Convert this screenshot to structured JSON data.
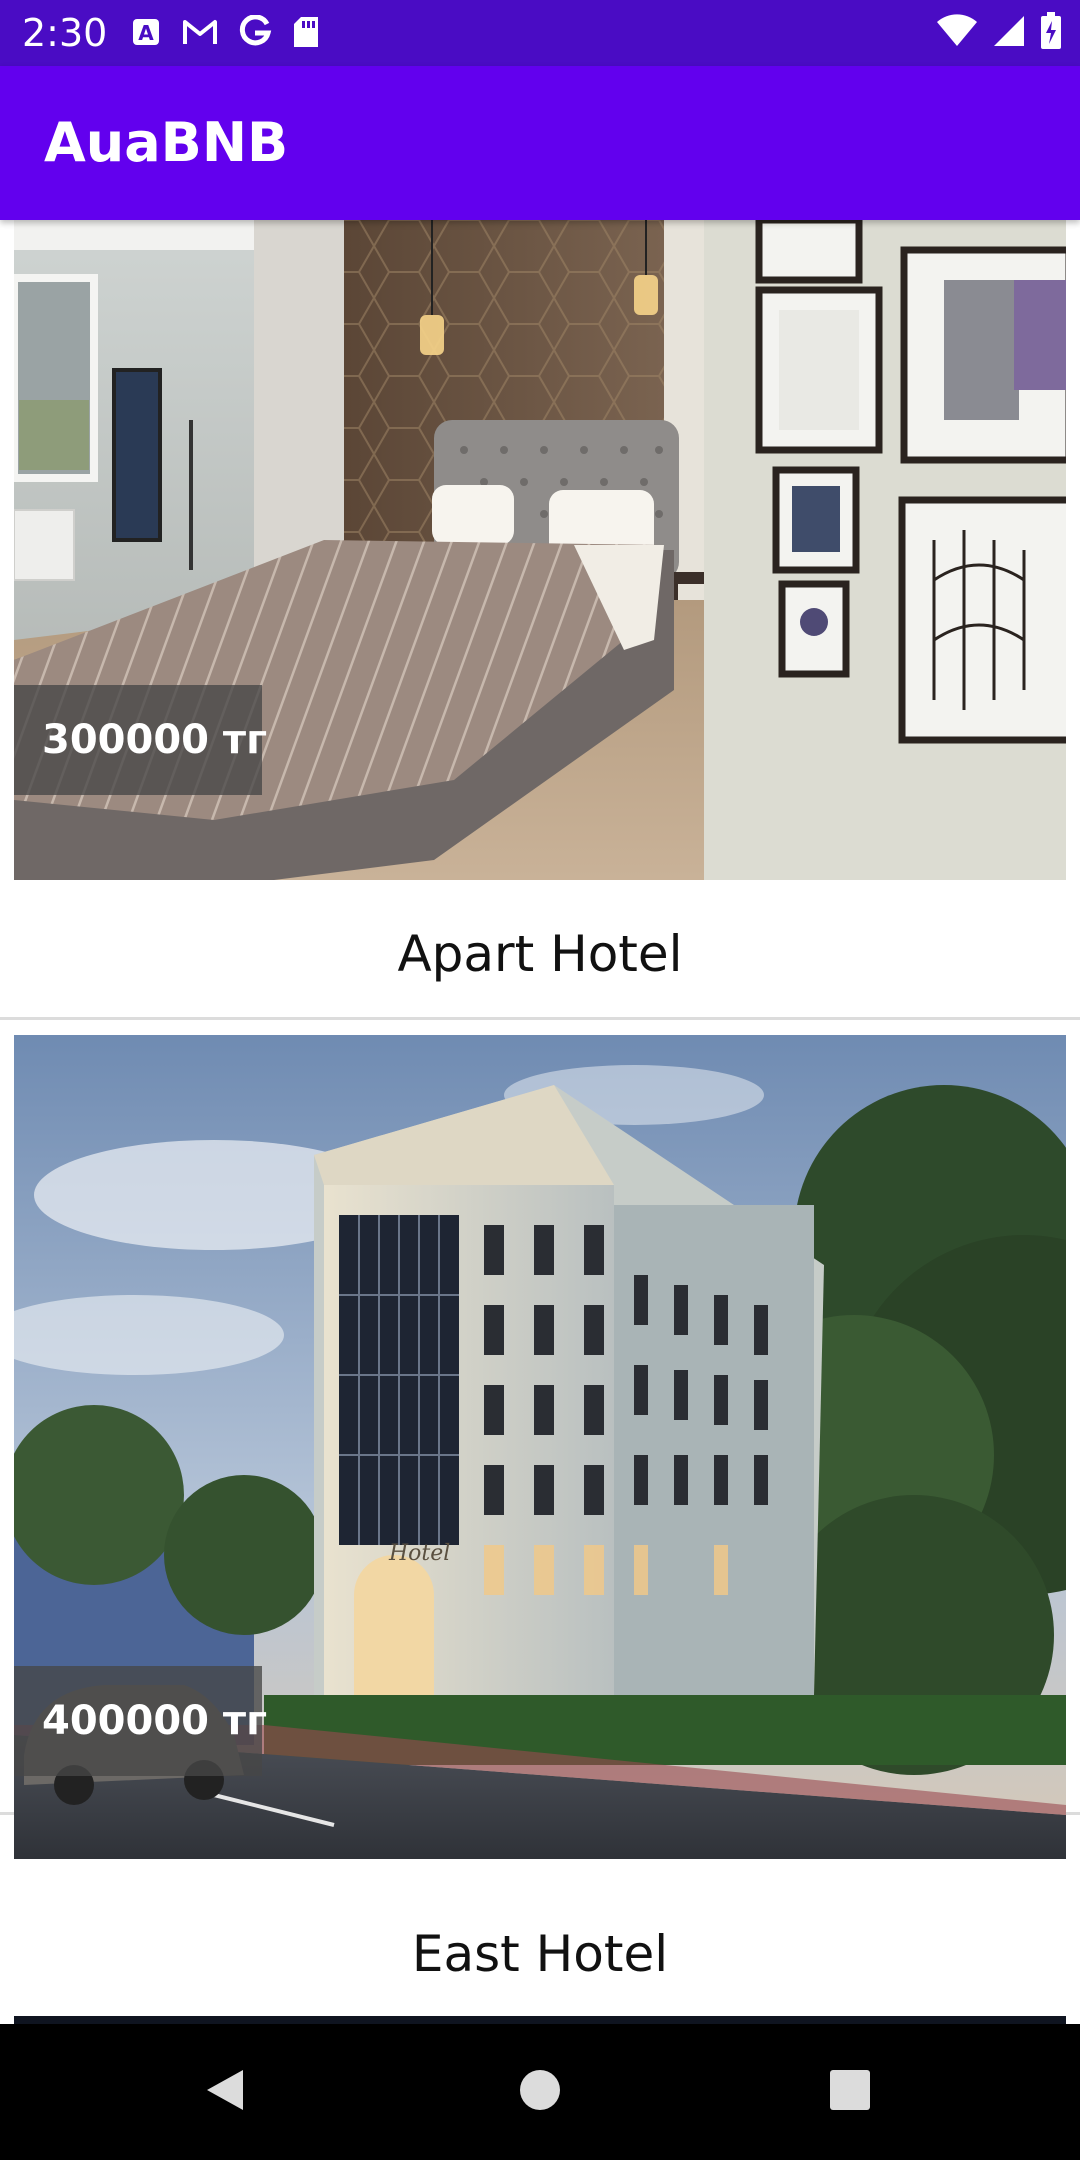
{
  "status_bar": {
    "time": "2:30",
    "left_icons": [
      "translate-a-icon",
      "gmail-icon",
      "google-g-icon",
      "sd-card-icon"
    ],
    "right_icons": [
      "wifi-icon",
      "cell-signal-icon",
      "battery-charging-icon"
    ]
  },
  "app_bar": {
    "title": "AuaBNB",
    "color": "#6200ee"
  },
  "listings": [
    {
      "price": "300000 тг",
      "name": "Apart Hotel",
      "image": "hotel-bedroom-photo"
    },
    {
      "price": "400000 тг",
      "name": "East Hotel",
      "image": "hotel-building-exterior-photo"
    },
    {
      "image": "hotel-photo-partially-visible"
    }
  ],
  "nav_bar": {
    "buttons": [
      "back-icon",
      "home-icon",
      "recents-icon"
    ]
  }
}
